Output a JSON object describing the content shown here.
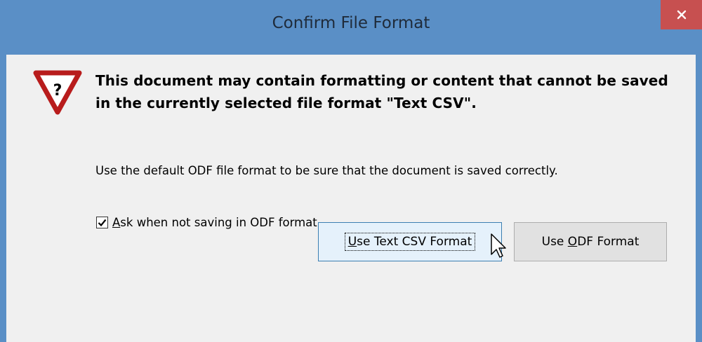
{
  "window": {
    "title": "Confirm File Format",
    "close_icon": "close-icon",
    "accent_color": "#5a8fc6",
    "close_color": "#c75050"
  },
  "dialog": {
    "icon": "warning-triangle-question-icon",
    "headline": "This document may contain formatting or content that cannot be saved in the currently selected file format \"Text CSV\".",
    "info": "Use the default ODF file format to be sure that the document is saved correctly.",
    "checkbox": {
      "checked": true,
      "mnemonic": "A",
      "rest": "sk when not saving in ODF format"
    }
  },
  "buttons": {
    "use_csv": {
      "mnemonic": "U",
      "rest": "se Text CSV Format"
    },
    "use_odf": {
      "pre": "Use ",
      "mnemonic": "O",
      "rest": "DF Format"
    }
  }
}
